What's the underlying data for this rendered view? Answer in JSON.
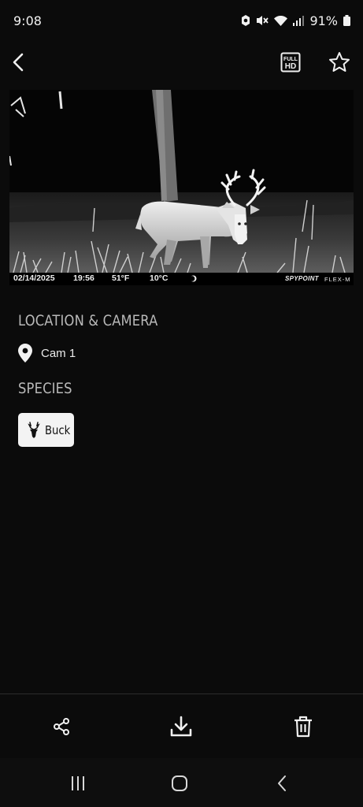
{
  "status_bar": {
    "time": "9:08",
    "battery": "91%",
    "icons": [
      "notification-icon",
      "mute-icon",
      "wifi-icon",
      "signal-icon",
      "battery-icon"
    ]
  },
  "app_bar": {
    "icons": [
      "back-arrow-icon",
      "full-hd-icon",
      "star-icon"
    ],
    "hd_text_top": "FULL",
    "hd_text_bottom": "HD"
  },
  "photo": {
    "date": "02/14/2025",
    "time": "19:56",
    "temp_f": "51°F",
    "temp_c": "10°C",
    "brand": "SPYPOINT",
    "model": "FLEX-M"
  },
  "location_section": {
    "title": "LOCATION & CAMERA",
    "camera_name": "Cam 1"
  },
  "species_section": {
    "title": "SPECIES",
    "chip_label": "Buck"
  },
  "actions": [
    "share-icon",
    "download-icon",
    "trash-icon"
  ],
  "nav": [
    "recent-apps-icon",
    "home-icon",
    "back-icon"
  ],
  "colors": {
    "background": "#0b0b0b",
    "section_title": "#b9b9b9",
    "chip_bg": "#f3f3f3"
  }
}
